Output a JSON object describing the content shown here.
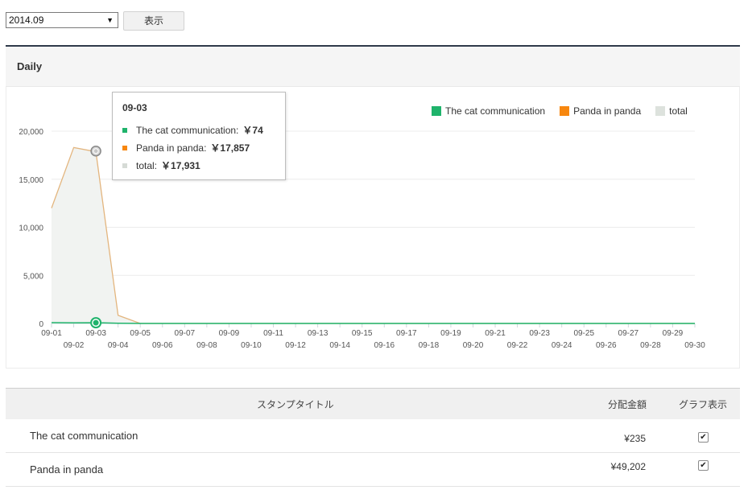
{
  "toolbar": {
    "month_select_value": "2014.09",
    "show_button_label": "表示"
  },
  "panel": {
    "title": "Daily"
  },
  "legend": [
    {
      "label": "The cat communication",
      "color": "#1fb36b"
    },
    {
      "label": "Panda in panda",
      "color": "#f7870f"
    },
    {
      "label": "total",
      "color": "#dde2dd"
    }
  ],
  "tooltip": {
    "title": "09-03",
    "rows": [
      {
        "label": "The cat communication:",
        "value": "￥74",
        "color": "#1fb36b"
      },
      {
        "label": "Panda in panda:",
        "value": "￥17,857",
        "color": "#f7870f"
      },
      {
        "label": "total:",
        "value": "￥17,931",
        "color": "#d6dbd6"
      }
    ]
  },
  "chart_data": {
    "type": "area",
    "title": "",
    "x": [
      "09-01",
      "09-02",
      "09-03",
      "09-04",
      "09-05",
      "09-06",
      "09-07",
      "09-08",
      "09-09",
      "09-10",
      "09-11",
      "09-12",
      "09-13",
      "09-14",
      "09-15",
      "09-16",
      "09-17",
      "09-18",
      "09-19",
      "09-20",
      "09-21",
      "09-22",
      "09-23",
      "09-24",
      "09-25",
      "09-26",
      "09-27",
      "09-28",
      "09-29",
      "09-30"
    ],
    "series": [
      {
        "name": "The cat communication",
        "values": [
          80,
          60,
          74,
          20,
          0,
          0,
          0,
          0,
          0,
          0,
          0,
          0,
          0,
          0,
          0,
          0,
          0,
          0,
          0,
          0,
          0,
          0,
          0,
          0,
          0,
          0,
          0,
          0,
          0,
          0
        ],
        "color": "#1fb36b"
      },
      {
        "name": "Panda in panda",
        "values": [
          12000,
          18300,
          17857,
          850,
          0,
          0,
          0,
          0,
          0,
          0,
          0,
          0,
          0,
          0,
          0,
          0,
          0,
          0,
          0,
          0,
          0,
          0,
          0,
          0,
          0,
          0,
          0,
          0,
          0,
          0
        ],
        "color": "#f7870f"
      },
      {
        "name": "total",
        "values": [
          12080,
          18360,
          17931,
          870,
          0,
          0,
          0,
          0,
          0,
          0,
          0,
          0,
          0,
          0,
          0,
          0,
          0,
          0,
          0,
          0,
          0,
          0,
          0,
          0,
          0,
          0,
          0,
          0,
          0,
          0
        ],
        "color": "#dde2dd"
      }
    ],
    "yticks": [
      "0",
      "5,000",
      "10,000",
      "15,000",
      "20,000"
    ],
    "ytick_values": [
      0,
      5000,
      10000,
      15000,
      20000
    ],
    "ylim": [
      0,
      20000
    ],
    "grid": true,
    "legend_position": "top-right",
    "highlight_x": "09-03"
  },
  "table": {
    "headers": {
      "title": "スタンプタイトル",
      "amount": "分配金額",
      "graph": "グラフ表示"
    },
    "rows": [
      {
        "title": "The cat communication",
        "amount": "¥235",
        "checked": "✔"
      },
      {
        "title": "Panda in panda",
        "amount": "¥49,202",
        "checked": "✔"
      }
    ]
  }
}
